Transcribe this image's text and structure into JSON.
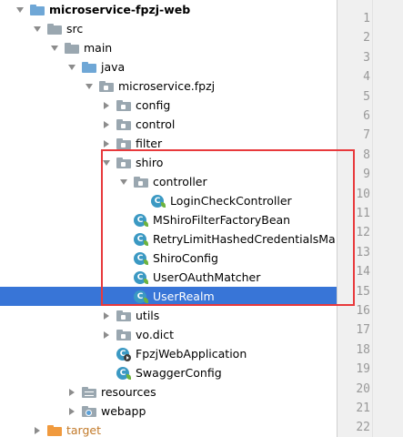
{
  "tree": [
    {
      "label": "microservice-fpzj-web",
      "icon": "module-folder-icon",
      "expanded": true,
      "depth": 0,
      "bold": true
    },
    {
      "label": "src",
      "icon": "folder-icon",
      "expanded": true,
      "depth": 1
    },
    {
      "label": "main",
      "icon": "folder-icon",
      "expanded": true,
      "depth": 2
    },
    {
      "label": "java",
      "icon": "source-folder-icon",
      "expanded": true,
      "depth": 3
    },
    {
      "label": "microservice.fpzj",
      "icon": "package-icon",
      "expanded": true,
      "depth": 4
    },
    {
      "label": "config",
      "icon": "package-icon",
      "expanded": false,
      "depth": 5
    },
    {
      "label": "control",
      "icon": "package-icon",
      "expanded": false,
      "depth": 5
    },
    {
      "label": "filter",
      "icon": "package-icon",
      "expanded": false,
      "depth": 5
    },
    {
      "label": "shiro",
      "icon": "package-icon",
      "expanded": true,
      "depth": 5
    },
    {
      "label": "controller",
      "icon": "package-icon",
      "expanded": true,
      "depth": 6
    },
    {
      "label": "LoginCheckController",
      "icon": "spring-class-icon",
      "depth": 7
    },
    {
      "label": "MShiroFilterFactoryBean",
      "icon": "spring-class-icon",
      "depth": 6
    },
    {
      "label": "RetryLimitHashedCredentialsMa",
      "icon": "spring-class-icon",
      "depth": 6
    },
    {
      "label": "ShiroConfig",
      "icon": "spring-class-icon",
      "depth": 6
    },
    {
      "label": "UserOAuthMatcher",
      "icon": "spring-class-icon",
      "depth": 6
    },
    {
      "label": "UserRealm",
      "icon": "spring-class-icon",
      "depth": 6,
      "selected": true
    },
    {
      "label": "utils",
      "icon": "package-icon",
      "expanded": false,
      "depth": 5
    },
    {
      "label": "vo.dict",
      "icon": "package-icon",
      "expanded": false,
      "depth": 5
    },
    {
      "label": "FpzjWebApplication",
      "icon": "run-class-icon",
      "depth": 5
    },
    {
      "label": "SwaggerConfig",
      "icon": "spring-class-icon",
      "depth": 5
    },
    {
      "label": "resources",
      "icon": "resources-folder-icon",
      "expanded": false,
      "depth": 3
    },
    {
      "label": "webapp",
      "icon": "web-folder-icon",
      "expanded": false,
      "depth": 3
    },
    {
      "label": "target",
      "icon": "excluded-folder-icon",
      "expanded": false,
      "depth": 1,
      "excluded": true
    }
  ],
  "line_numbers": [
    "1",
    "2",
    "3",
    "4",
    "5",
    "6",
    "7",
    "8",
    "9",
    "10",
    "11",
    "12",
    "13",
    "14",
    "15",
    "16",
    "17",
    "18",
    "19",
    "20",
    "21",
    "22"
  ],
  "colors": {
    "selection": "#3875d7",
    "annotation_box": "#e8393c",
    "gutter": "#f0f0f0"
  }
}
